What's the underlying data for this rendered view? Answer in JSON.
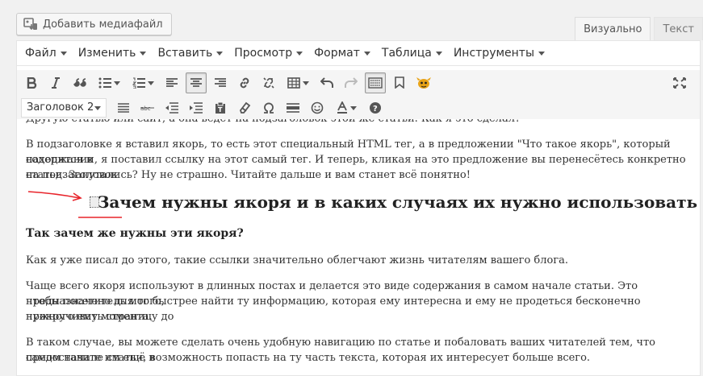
{
  "media_button": {
    "label": "Добавить медиафайл"
  },
  "mode_tabs": [
    {
      "label": "Визуально",
      "active": true
    },
    {
      "label": "Текст",
      "active": false
    }
  ],
  "menubar": [
    {
      "label": "Файл"
    },
    {
      "label": "Изменить"
    },
    {
      "label": "Вставить"
    },
    {
      "label": "Просмотр"
    },
    {
      "label": "Формат"
    },
    {
      "label": "Таблица"
    },
    {
      "label": "Инструменты"
    }
  ],
  "toolbar": {
    "format_select_value": "Заголовок 2"
  },
  "content": {
    "cut_line": "Другую статью или сайт, а она ведет на подзаголовок этой же статьи. Как я это сделал?",
    "p1_line1": "В подзаголовке я вставил якорь, то есть этот специальный HTML тег, а в предложении \"Что такое якорь\", который находится в",
    "p1_line2": "содержании, я поставил ссылку на этот самый тег. И теперь, кликая на это предложение вы перенесётесь конкретно на подзаголовок",
    "p1_line3": "статьи. Запутались? Ну не страшно. Читайте дальше и вам станет всё понятно!",
    "h2": "Зачем нужны якоря и в каких случаях их нужно использовать",
    "h3": "Так зачем же нужны эти якоря?",
    "p2": "Как я уже писал до этого, такие ссылки значительно облегчают жизнь читателям вашего блога.",
    "p3_line1": "Чаще всего якоря используют в длинных постах и делается это виде содержания в самом начале статьи. Это предназначено для того,",
    "p3_line2": "чтобы посетитель мог быстрее найти ту информацию, которая ему интересна и ему не продеться бесконечно прокручивать страницу до",
    "p3_line3": "нужного ему момента.",
    "p4_line1": "В таком случае, вы можете сделать очень удобную навигацию по статье и побаловать ваших читателей тем, что предоставите им ещё в",
    "p4_line2": "самом начале статьи, возможность попасть на ту часть текста, которая их интересует больше всего."
  },
  "colors": {
    "annotation_red": "#e8232a",
    "active_tab_bg": "#f5f5f5"
  }
}
